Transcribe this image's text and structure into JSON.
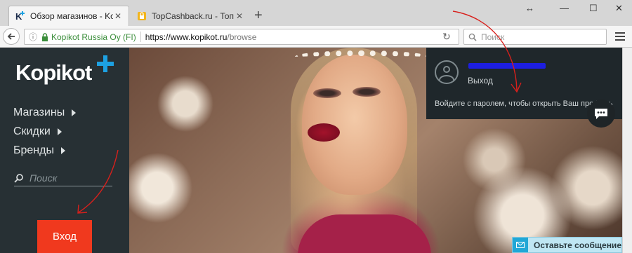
{
  "browser": {
    "tabs": [
      {
        "title": "Обзор магазинов - Kopikot",
        "active": true
      },
      {
        "title": "TopCashback.ru - Топ лу...",
        "active": false
      }
    ],
    "identity": "Kopikot Russia Oy (FI)",
    "url_host": "https://www.kopikot.ru",
    "url_path": "/browse",
    "search_placeholder": "Поиск"
  },
  "sidebar": {
    "logo": "Kopikot",
    "nav": [
      {
        "label": "Магазины"
      },
      {
        "label": "Скидки"
      },
      {
        "label": "Бренды"
      }
    ],
    "search_placeholder": "Поиск",
    "login_label": "Вход"
  },
  "account_popup": {
    "logout_label": "Выход",
    "message": "Войдите с паролем, чтобы открыть Ваш профиль"
  },
  "feedback_label": "Оставьте сообщение",
  "colors": {
    "sidebar_bg": "#273034",
    "accent_blue": "#1da1e2",
    "login_btn": "#f0391e",
    "secure_green": "#3b8e3b",
    "annotation_red": "#d8201c"
  }
}
